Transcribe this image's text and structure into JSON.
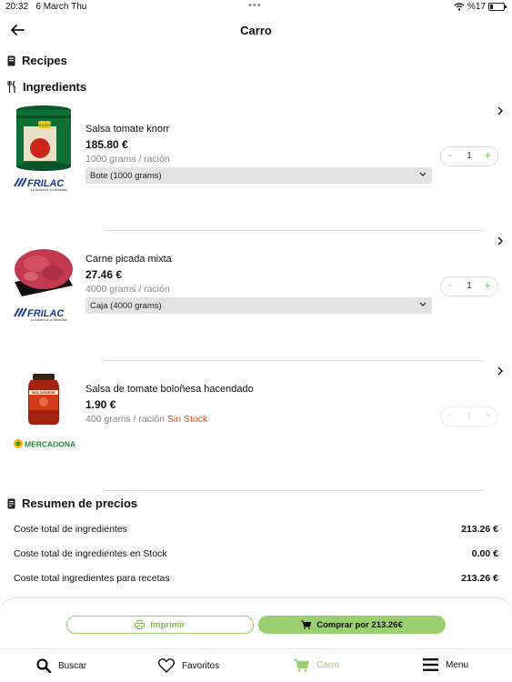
{
  "status": {
    "time": "20:32",
    "date": "6 March Thu",
    "battery": "%17"
  },
  "header": {
    "title": "Carro"
  },
  "sections": {
    "recipes": "Recipes",
    "ingredients": "Ingredients",
    "summary": "Resumen de precios"
  },
  "products": [
    {
      "name": "Salsa tomate knorr",
      "price": "185.80 €",
      "ration": "1000 grams / ración",
      "stock": "",
      "select": "Bote (1000 grams)",
      "quantity": "1",
      "supplier": "FRILAC",
      "supplier_tagline": "La Solución a su Necesidad",
      "image_label": "KNORR"
    },
    {
      "name": "Carne picada mixta",
      "price": "27.46 €",
      "ration": "4000 grams / ración",
      "stock": "",
      "select": "Caja (4000 grams)",
      "quantity": "1",
      "supplier": "FRILAC",
      "supplier_tagline": "La Solución a su Necesidad"
    },
    {
      "name": "Salsa de tomate boloñesa hacendado",
      "price": "1.90 €",
      "ration": "400 grams / ración",
      "stock": "Sin Stock",
      "quantity": "1",
      "supplier": "MERCADONA",
      "image_label": "BOLOGNESE"
    }
  ],
  "summary": [
    {
      "label": "Coste total de ingredientes",
      "value": "213.26 €"
    },
    {
      "label": "Coste total de ingredientes en Stock",
      "value": "0.00 €"
    },
    {
      "label": "Coste total ingredientes para recetas",
      "value": "213.26 €"
    }
  ],
  "actions": {
    "print": "Imprimir",
    "buy": "Comprar por 213.26€"
  },
  "tabs": [
    {
      "label": "Buscar",
      "icon": "search-icon"
    },
    {
      "label": "Favoritos",
      "icon": "heart-icon"
    },
    {
      "label": "Carro",
      "icon": "cart-icon",
      "active": true
    },
    {
      "label": "Menu",
      "icon": "menu-icon"
    }
  ],
  "colors": {
    "accent": "#9ccf72",
    "accent_dark": "#7cbf4a",
    "out_of_stock": "#e0561b"
  }
}
